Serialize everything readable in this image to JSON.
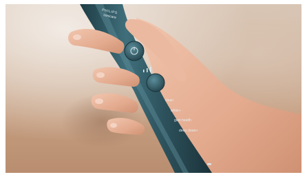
{
  "brand": {
    "line1": "PHILIPS",
    "line2": "sonicare"
  },
  "modes": [
    {
      "label": "clean"
    },
    {
      "label": "white+"
    },
    {
      "label": "gum health"
    },
    {
      "label": "deep clean+"
    }
  ],
  "colors": {
    "handle": "#2f5560",
    "handle_highlight": "#4a7a86",
    "skin": "#e9b69c",
    "background": "#c8a285"
  },
  "icons": [
    "power-button-icon",
    "mode-button-icon",
    "intensity-dots-icon",
    "charge-indicator-icon"
  ]
}
